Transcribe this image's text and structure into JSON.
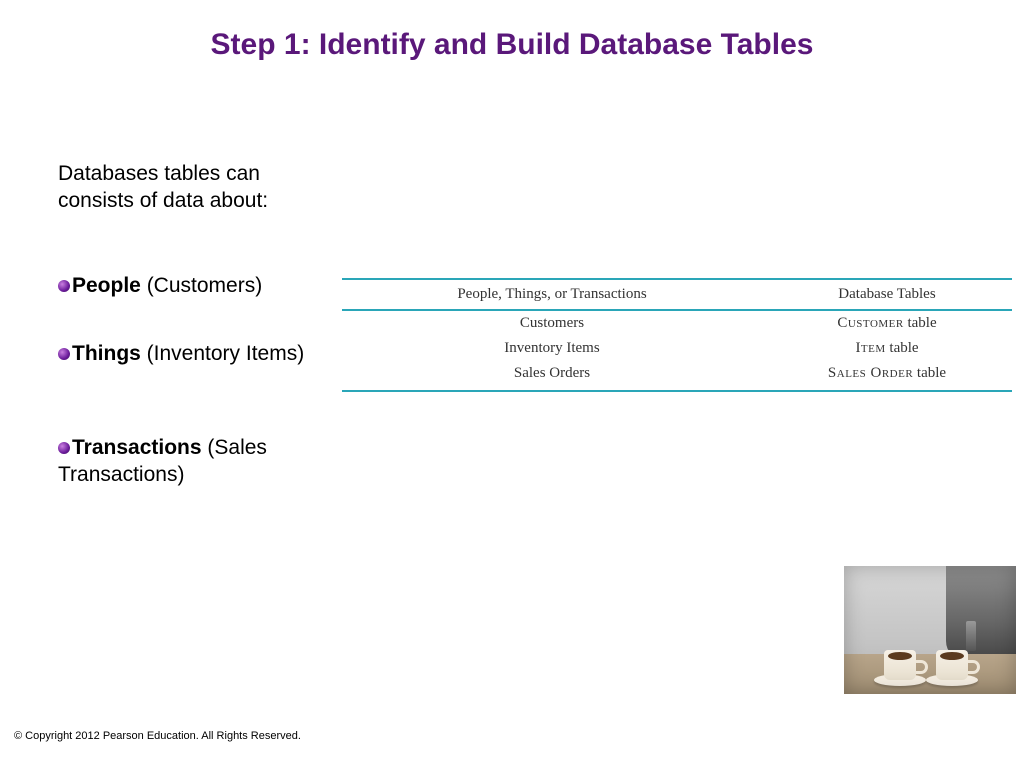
{
  "title": "Step 1: Identify and Build Database Tables",
  "intro": "Databases tables can consists of data about:",
  "bullets": [
    {
      "bold": "People",
      "rest": " (Customers)"
    },
    {
      "bold": "Things",
      "rest": " (Inventory Items)"
    },
    {
      "bold": "Transactions",
      "rest": " (Sales Transactions)"
    }
  ],
  "table": {
    "headers": {
      "col1": "People, Things, or Transactions",
      "col2": "Database Tables"
    },
    "rows": [
      {
        "left": "Customers",
        "right_sc": "Customer",
        "right_suffix": " table"
      },
      {
        "left": "Inventory Items",
        "right_sc": "Item",
        "right_suffix": " table"
      },
      {
        "left": "Sales Orders",
        "right_sc": "Sales Order",
        "right_suffix": " table"
      }
    ]
  },
  "copyright": "© Copyright 2012 Pearson Education. All Rights Reserved."
}
